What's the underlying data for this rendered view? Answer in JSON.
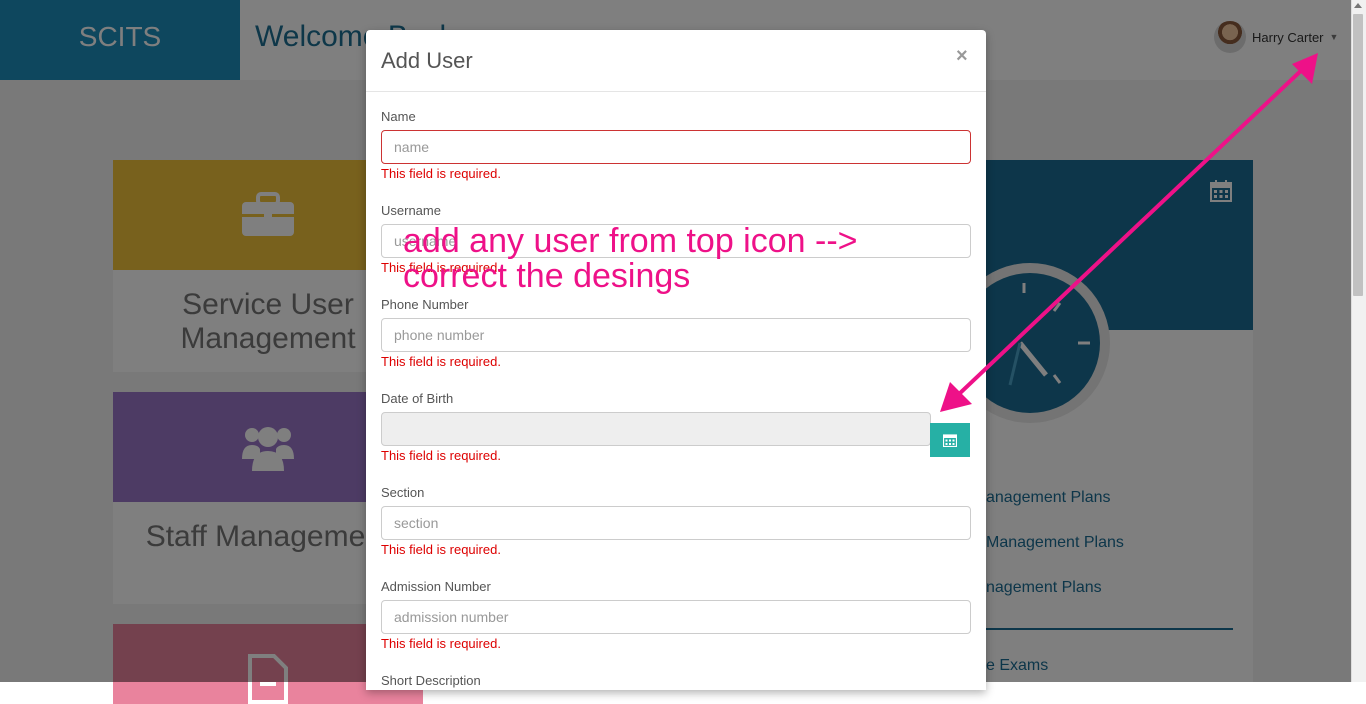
{
  "app": {
    "brand": "SCITS",
    "welcome": "Welcome Back"
  },
  "user": {
    "name": "Harry Carter"
  },
  "tiles": [
    {
      "label": "Service User Management",
      "color": "#f0c33a",
      "icon": "briefcase-icon"
    },
    {
      "label": "Staff Management",
      "color": "#9a76c9",
      "icon": "users-icon"
    },
    {
      "label": "",
      "color": "#e9839d",
      "icon": "document-icon"
    }
  ],
  "right_panel": {
    "icon": "calendar-icon",
    "plans": [
      "anagement Plans",
      "Management Plans",
      "nagement Plans"
    ],
    "exams": "e Exams"
  },
  "modal": {
    "title": "Add User",
    "close": "×",
    "fields": [
      {
        "label": "Name",
        "placeholder": "name",
        "error": "This field is required."
      },
      {
        "label": "Username",
        "placeholder": "username",
        "error": "This field is required."
      },
      {
        "label": "Phone Number",
        "placeholder": "phone number",
        "error": "This field is required."
      },
      {
        "label": "Date of Birth",
        "placeholder": "",
        "error": "This field is required."
      },
      {
        "label": "Section",
        "placeholder": "section",
        "error": "This field is required."
      },
      {
        "label": "Admission Number",
        "placeholder": "admission number",
        "error": "This field is required."
      },
      {
        "label": "Short Description"
      }
    ]
  },
  "annotation": {
    "line1": "add any user from top icon -->",
    "line2": "correct the desings",
    "color": "#ee1188"
  },
  "colors": {
    "brand": "#1d8fbd",
    "accent_teal": "#26b0a5",
    "error": "#dd0000"
  }
}
